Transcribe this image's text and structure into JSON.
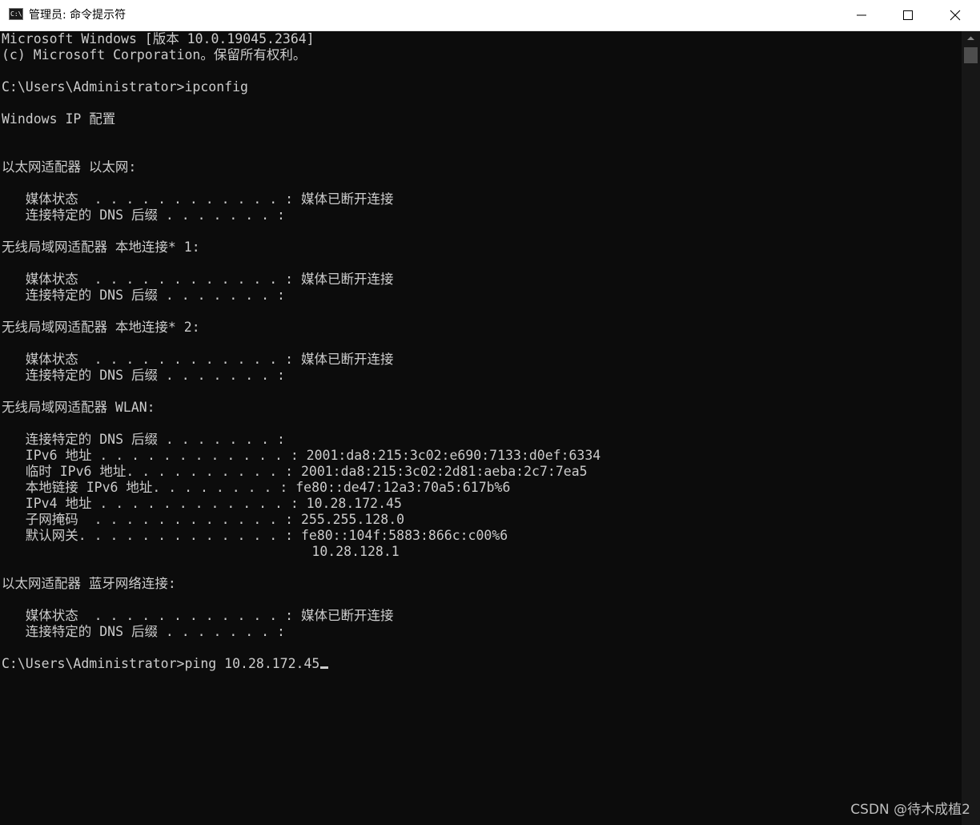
{
  "window": {
    "title": "管理员: 命令提示符",
    "icon_label": "C:\\.",
    "buttons": {
      "minimize_icon": "minimize-icon",
      "maximize_icon": "maximize-icon",
      "close_icon": "close-icon"
    }
  },
  "console": {
    "lines": [
      "Microsoft Windows [版本 10.0.19045.2364]",
      "(c) Microsoft Corporation。保留所有权利。",
      "",
      "C:\\Users\\Administrator>ipconfig",
      "",
      "Windows IP 配置",
      "",
      "",
      "以太网适配器 以太网:",
      "",
      "   媒体状态  . . . . . . . . . . . . : 媒体已断开连接",
      "   连接特定的 DNS 后缀 . . . . . . . :",
      "",
      "无线局域网适配器 本地连接* 1:",
      "",
      "   媒体状态  . . . . . . . . . . . . : 媒体已断开连接",
      "   连接特定的 DNS 后缀 . . . . . . . :",
      "",
      "无线局域网适配器 本地连接* 2:",
      "",
      "   媒体状态  . . . . . . . . . . . . : 媒体已断开连接",
      "   连接特定的 DNS 后缀 . . . . . . . :",
      "",
      "无线局域网适配器 WLAN:",
      "",
      "   连接特定的 DNS 后缀 . . . . . . . :",
      "   IPv6 地址 . . . . . . . . . . . . : 2001:da8:215:3c02:e690:7133:d0ef:6334",
      "   临时 IPv6 地址. . . . . . . . . . : 2001:da8:215:3c02:2d81:aeba:2c7:7ea5",
      "   本地链接 IPv6 地址. . . . . . . . : fe80::de47:12a3:70a5:617b%6",
      "   IPv4 地址 . . . . . . . . . . . . : 10.28.172.45",
      "   子网掩码  . . . . . . . . . . . . : 255.255.128.0",
      "   默认网关. . . . . . . . . . . . . : fe80::104f:5883:866c:c00%6",
      "                                       10.28.128.1",
      "",
      "以太网适配器 蓝牙网络连接:",
      "",
      "   媒体状态  . . . . . . . . . . . . : 媒体已断开连接",
      "   连接特定的 DNS 后缀 . . . . . . . :",
      "",
      "C:\\Users\\Administrator>ping 10.28.172.45"
    ]
  },
  "watermark": "CSDN @待木成植2",
  "colors": {
    "console_background": "#0c0c0c",
    "console_text": "#cccccc",
    "titlebar_background": "#ffffff",
    "scrollbar_track": "#171717",
    "scrollbar_thumb": "#4d4d4d"
  }
}
